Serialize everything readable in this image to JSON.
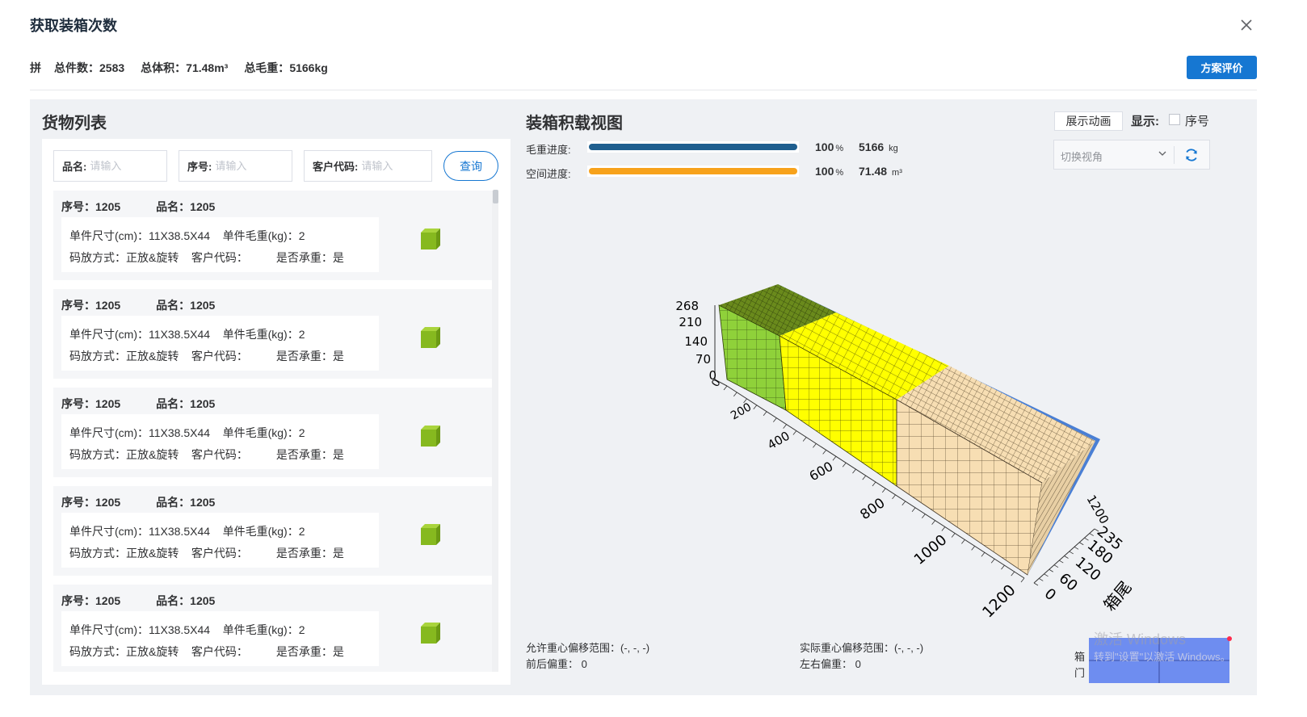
{
  "dialog": {
    "title": "获取装箱次数",
    "summary": {
      "tag": "拼",
      "total_count_label": "总件数：",
      "total_count": "2583",
      "total_volume_label": "总体积：",
      "total_volume": "71.48m³",
      "total_weight_label": "总毛重：",
      "total_weight": "5166kg"
    },
    "eval_button": "方案评价"
  },
  "goods_list": {
    "title": "货物列表",
    "filters": [
      {
        "label": "品名:",
        "placeholder": "请输入"
      },
      {
        "label": "序号:",
        "placeholder": "请输入"
      },
      {
        "label": "客户代码:",
        "placeholder": "请输入"
      }
    ],
    "query_button": "查询",
    "items": [
      {
        "serial_label": "序号：",
        "serial": "1205",
        "name_label": "品名：",
        "name": "1205",
        "size": "单件尺寸(cm)：11X38.5X44",
        "weight": "单件毛重(kg)：2",
        "placement": "码放方式：正放&旋转",
        "customer": "客户代码：",
        "load_bearing": "是否承重：是"
      },
      {
        "serial_label": "序号：",
        "serial": "1205",
        "name_label": "品名：",
        "name": "1205",
        "size": "单件尺寸(cm)：11X38.5X44",
        "weight": "单件毛重(kg)：2",
        "placement": "码放方式：正放&旋转",
        "customer": "客户代码：",
        "load_bearing": "是否承重：是"
      },
      {
        "serial_label": "序号：",
        "serial": "1205",
        "name_label": "品名：",
        "name": "1205",
        "size": "单件尺寸(cm)：11X38.5X44",
        "weight": "单件毛重(kg)：2",
        "placement": "码放方式：正放&旋转",
        "customer": "客户代码：",
        "load_bearing": "是否承重：是"
      },
      {
        "serial_label": "序号：",
        "serial": "1205",
        "name_label": "品名：",
        "name": "1205",
        "size": "单件尺寸(cm)：11X38.5X44",
        "weight": "单件毛重(kg)：2",
        "placement": "码放方式：正放&旋转",
        "customer": "客户代码：",
        "load_bearing": "是否承重：是"
      },
      {
        "serial_label": "序号：",
        "serial": "1205",
        "name_label": "品名：",
        "name": "1205",
        "size": "单件尺寸(cm)：11X38.5X44",
        "weight": "单件毛重(kg)：2",
        "placement": "码放方式：正放&旋转",
        "customer": "客户代码：",
        "load_bearing": "是否承重：是"
      }
    ],
    "item_color": "#8fbf2a"
  },
  "loading_view": {
    "title": "装箱积载视图",
    "anim_button": "展示动画",
    "show_label": "显示:",
    "serial_checkbox_label": "序号",
    "serial_checkbox_checked": false,
    "view_select_placeholder": "切换视角",
    "weight_progress": {
      "label": "毛重进度:",
      "percent": 100,
      "percent_unit": "%",
      "amount": "5166",
      "unit": "kg",
      "color": "#1f5f8f"
    },
    "space_progress": {
      "label": "空间进度:",
      "percent": 100,
      "percent_unit": "%",
      "amount": "71.48",
      "unit": "m³",
      "color": "#f7a21b"
    },
    "axes": {
      "height_ticks": [
        "268",
        "210",
        "140",
        "70",
        "0"
      ],
      "length_ticks": [
        "0",
        "200",
        "400",
        "600",
        "800",
        "1000",
        "1200"
      ],
      "end_length_tick": "1200",
      "width_ticks": [
        "0",
        "60",
        "120",
        "180",
        "235"
      ],
      "tail_label": "箱尾"
    },
    "cargo_colors": {
      "green": "#8fd13a",
      "yellow": "#ffff00",
      "tan": "#f7deb3",
      "container_edge": "#4a7fd4"
    },
    "allowed_cg_range": "允许重心偏移范围：(-, -, -)",
    "front_back_offset": "前后偏重：  0",
    "actual_cg_range": "实际重心偏移范围：(-, -, -)",
    "left_right_offset": "左右偏重：  0",
    "door_label_1": "箱",
    "door_label_2": "门"
  },
  "os_watermark": {
    "line1": "激活 Windows",
    "line2": "转到\"设置\"以激活 Windows。"
  }
}
